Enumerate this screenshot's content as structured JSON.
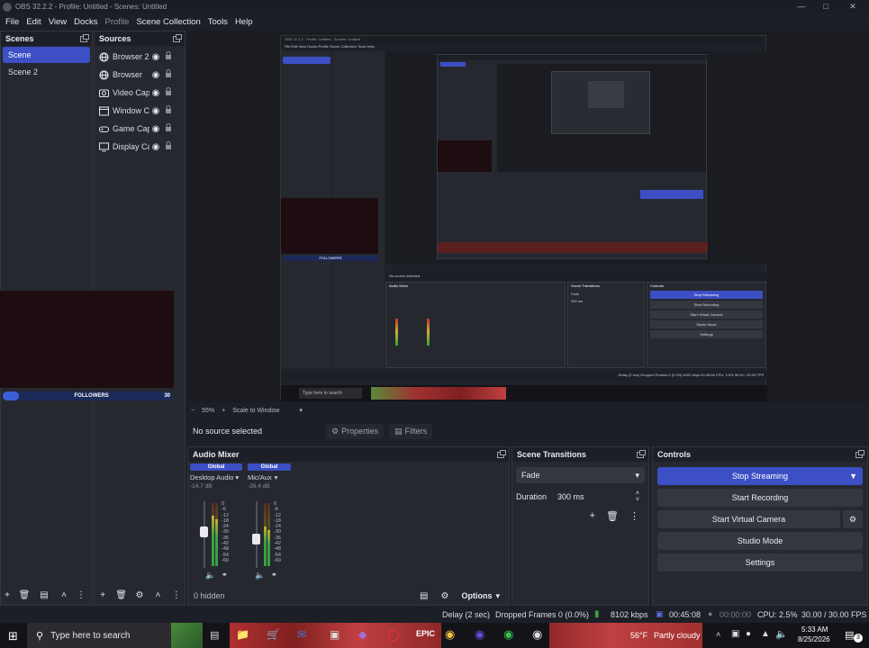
{
  "window": {
    "title": "OBS 32.2.2 - Profile: Untitled - Scenes: Untitled"
  },
  "menu": [
    "File",
    "Edit",
    "View",
    "Docks",
    "Profile",
    "Scene Collection",
    "Tools",
    "Help"
  ],
  "scenes_dock": {
    "title": "Scenes",
    "items": [
      {
        "label": "Scene",
        "active": true
      },
      {
        "label": "Scene 2",
        "active": false
      }
    ]
  },
  "sources_dock": {
    "title": "Sources",
    "items": [
      {
        "label": "Browser 2",
        "icon": "globe-icon"
      },
      {
        "label": "Browser",
        "icon": "globe-icon"
      },
      {
        "label": "Video Cap",
        "icon": "camera-icon"
      },
      {
        "label": "Window C",
        "icon": "window-icon"
      },
      {
        "label": "Game Cap",
        "icon": "gamepad-icon"
      },
      {
        "label": "Display Ca",
        "icon": "monitor-icon"
      }
    ]
  },
  "followers_widget": {
    "label": "FOLLOWERS",
    "count": "30"
  },
  "nested_preview": {
    "title": "OBS 32.2.2 - Profile: Untitled - Scenes: Untitled",
    "no_source": "No source selected",
    "properties": "Properties",
    "filters": "Filters",
    "audio_mixer": "Audio Mixer",
    "scene_transitions": "Scene Transitions",
    "controls": "Controls",
    "fade": "Fade",
    "duration": "Duration",
    "duration_value": "300 ms",
    "stop_streaming": "Stop Streaming",
    "start_recording": "Start Recording",
    "start_virtual_camera": "Start Virtual Camera",
    "studio_mode": "Studio Mode",
    "settings": "Settings",
    "search_placeholder": "Type here to search",
    "followers": "FOLLOWERS",
    "hidden": "0 hidden",
    "options": "Options",
    "zoom": "55%",
    "scale": "Scale to Window",
    "status": "Delay (2 sec)   Dropped Frames 0 (0.0%)   8102 kbps   00:45:08   CPU: 2.5%   30.00 / 30.00 FPS"
  },
  "preview_footer": {
    "zoom": "55%",
    "scale_label": "Scale to Window"
  },
  "context_bar": {
    "no_source": "No source selected",
    "properties": "Properties",
    "filters": "Filters"
  },
  "audio_mixer": {
    "title": "Audio Mixer",
    "channels": [
      {
        "badge": "Global",
        "name": "Desktop Audio",
        "db": "-14.7 dB",
        "level": 0.82
      },
      {
        "badge": "Global",
        "name": "Mic/Aux",
        "db": "-26.4 dB",
        "level": 0.62
      }
    ],
    "scale": [
      "0",
      "-6",
      "-12",
      "-18",
      "-24",
      "-30",
      "-36",
      "-42",
      "-48",
      "-54",
      "-60"
    ],
    "hidden_label": "0 hidden",
    "options_label": "Options"
  },
  "scene_transitions": {
    "title": "Scene Transitions",
    "transition": "Fade",
    "duration_label": "Duration",
    "duration_value": "300 ms"
  },
  "controls": {
    "title": "Controls",
    "stop_streaming": "Stop Streaming",
    "start_recording": "Start Recording",
    "start_virtual_camera": "Start Virtual Camera",
    "studio_mode": "Studio Mode",
    "settings": "Settings"
  },
  "status_bar": {
    "delay": "Delay (2 sec)",
    "dropped_frames": "Dropped Frames 0 (0.0%)",
    "bitrate": "8102 kbps",
    "stream_time": "00:45:08",
    "record_time": "00:00:00",
    "cpu": "CPU: 2.5%",
    "fps": "30.00 / 30.00 FPS"
  },
  "taskbar": {
    "search_placeholder": "Type here to search",
    "weather_temp": "56°F",
    "weather": "Partly cloudy",
    "time": "5:33 AM",
    "date": "8/25/2026",
    "notification_count": "3"
  },
  "colors": {
    "accent": "#3c4fc5",
    "panel": "#262830",
    "bg": "#1d1f26",
    "meter_green": "#3aa043",
    "meter_yellow": "#c8b030",
    "meter_red": "#c83030"
  }
}
